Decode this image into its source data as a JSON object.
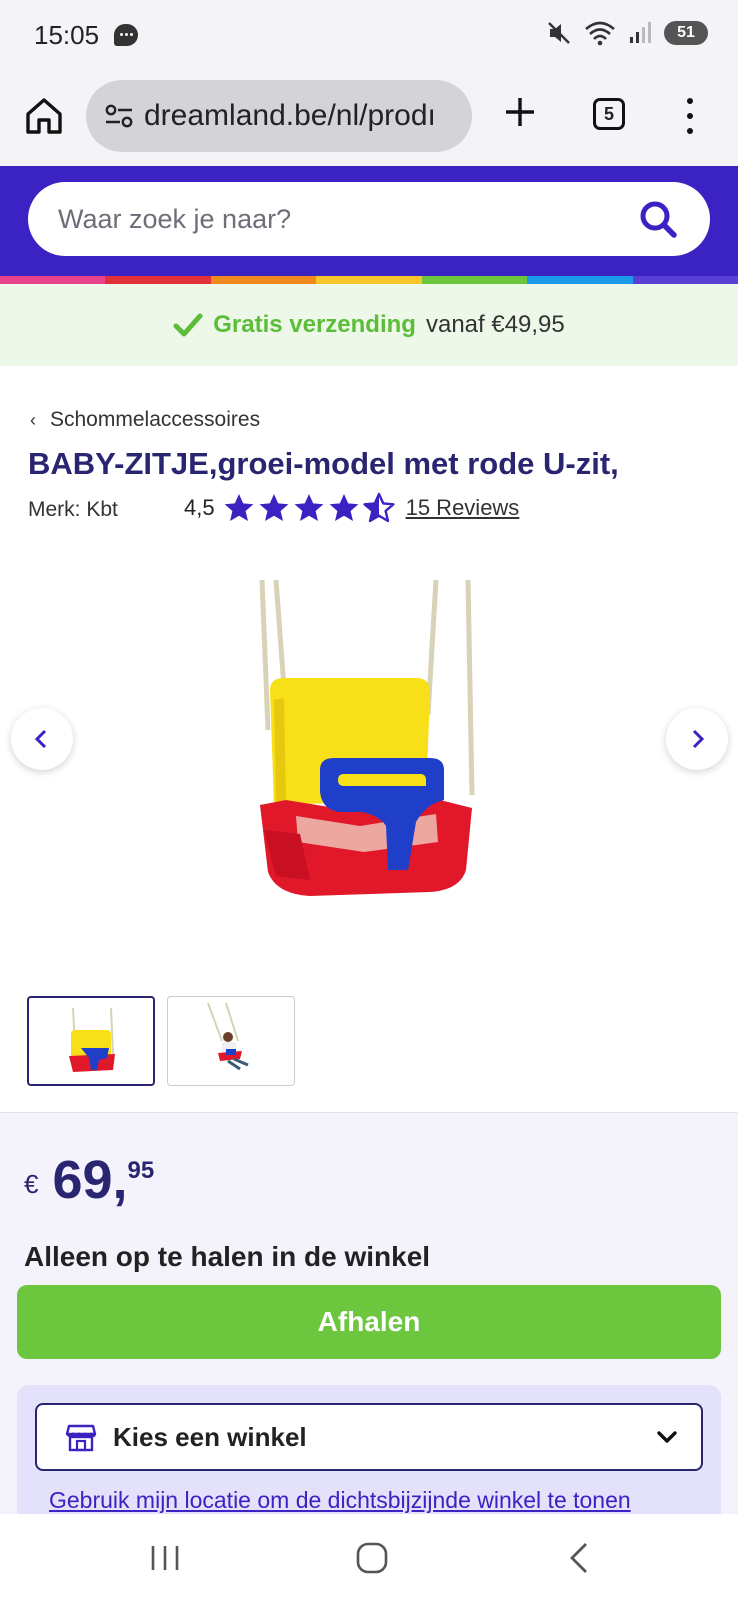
{
  "status_bar": {
    "time": "15:05",
    "battery": "51"
  },
  "browser": {
    "url": "dreamland.be/nl/prodı",
    "tab_count": "5"
  },
  "search": {
    "placeholder": "Waar zoek je naar?"
  },
  "shipping": {
    "strong": "Gratis verzending",
    "rest": "vanaf €49,95"
  },
  "product": {
    "breadcrumb": "Schommelaccessoires",
    "title": "BABY-ZITJE,groei-model met rode U-zit,",
    "brand": "Merk: Kbt",
    "rating": "4,5",
    "reviews": "15 Reviews"
  },
  "price": {
    "currency": "€",
    "main": "69,",
    "cents": "95"
  },
  "pickup": {
    "note": "Alleen op te halen in de winkel",
    "button": "Afhalen",
    "store_select": "Kies een winkel",
    "location_link": "Gebruik mijn locatie om de dichtsbijzijnde winkel te tonen"
  },
  "colors": {
    "brand_purple": "#3b22c2",
    "title_navy": "#2a2570",
    "green": "#6cc73f",
    "rainbow": [
      "#e8428c",
      "#e0303a",
      "#f08a1e",
      "#f7c52c",
      "#6cc73f",
      "#1e9be8",
      "#5a3fd6"
    ]
  }
}
